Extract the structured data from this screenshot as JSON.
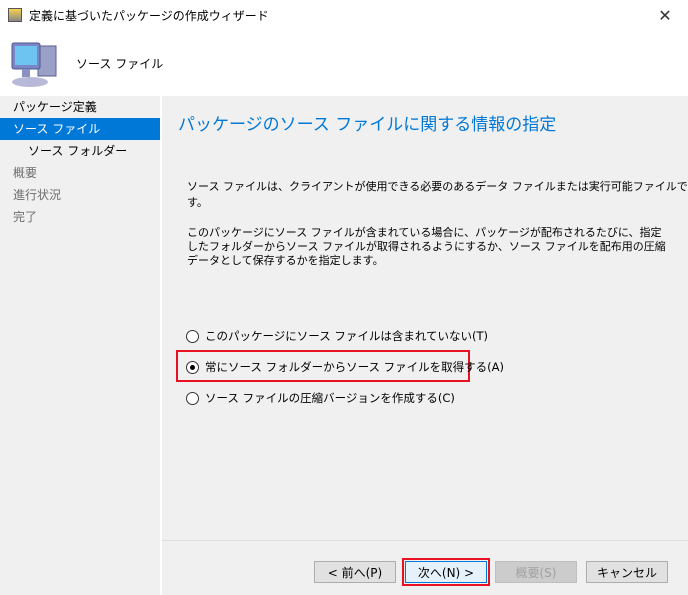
{
  "window": {
    "title": "定義に基づいたパッケージの作成ウィザード",
    "close_label": "✕"
  },
  "header": {
    "step_title": "ソース ファイル"
  },
  "sidebar": {
    "items": [
      {
        "label": "パッケージ定義"
      },
      {
        "label": "ソース ファイル"
      },
      {
        "label": "ソース フォルダー"
      },
      {
        "label": "概要"
      },
      {
        "label": "進行状況"
      },
      {
        "label": "完了"
      }
    ]
  },
  "main": {
    "heading": "パッケージのソース ファイルに関する情報の指定",
    "description1": "ソース ファイルは、クライアントが使用できる必要のあるデータ ファイルまたは実行可能ファイルです。",
    "description2": "このパッケージにソース ファイルが含まれている場合に、パッケージが配布されるたびに、指定したフォルダーからソース ファイルが取得されるようにするか、ソース ファイルを配布用の圧縮データとして保存するかを指定します。",
    "options": [
      {
        "label": "このパッケージにソース ファイルは含まれていない(T)",
        "selected": false
      },
      {
        "label": "常にソース フォルダーからソース ファイルを取得する(A)",
        "selected": true
      },
      {
        "label": "ソース ファイルの圧縮バージョンを作成する(C)",
        "selected": false
      }
    ]
  },
  "buttons": {
    "prev": "< 前へ(P)",
    "next": "次へ(N) >",
    "summary": "概要(S)",
    "cancel": "キャンセル"
  },
  "colors": {
    "accent": "#0078d7",
    "highlight": "#e81123"
  }
}
